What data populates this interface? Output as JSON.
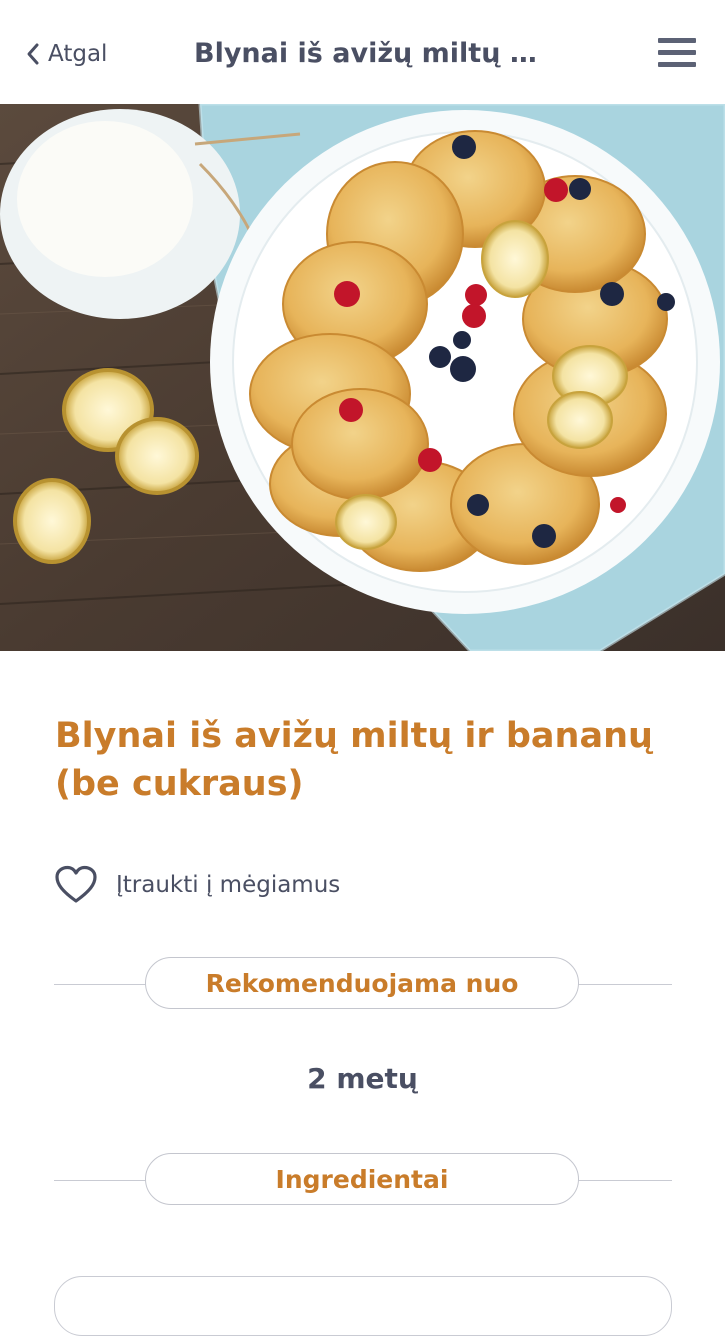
{
  "header": {
    "back_label": "Atgal",
    "title": "Blynai iš avižų miltų ...",
    "back_icon": "chevron-left-icon",
    "menu_icon": "hamburger-menu-icon"
  },
  "recipe": {
    "title": "Blynai iš avižų miltų ir bananų (be cukraus)",
    "favorite_label": "Įtraukti į mėgiamus",
    "favorite_icon": "heart-outline-icon"
  },
  "sections": {
    "recommended_label": "Rekomenduojama nuo",
    "recommended_value": "2 metų",
    "ingredients_label": "Ingredientai"
  },
  "colors": {
    "accent": "#c97c2a",
    "text": "#4a4f63",
    "border": "#c9cbd3"
  }
}
